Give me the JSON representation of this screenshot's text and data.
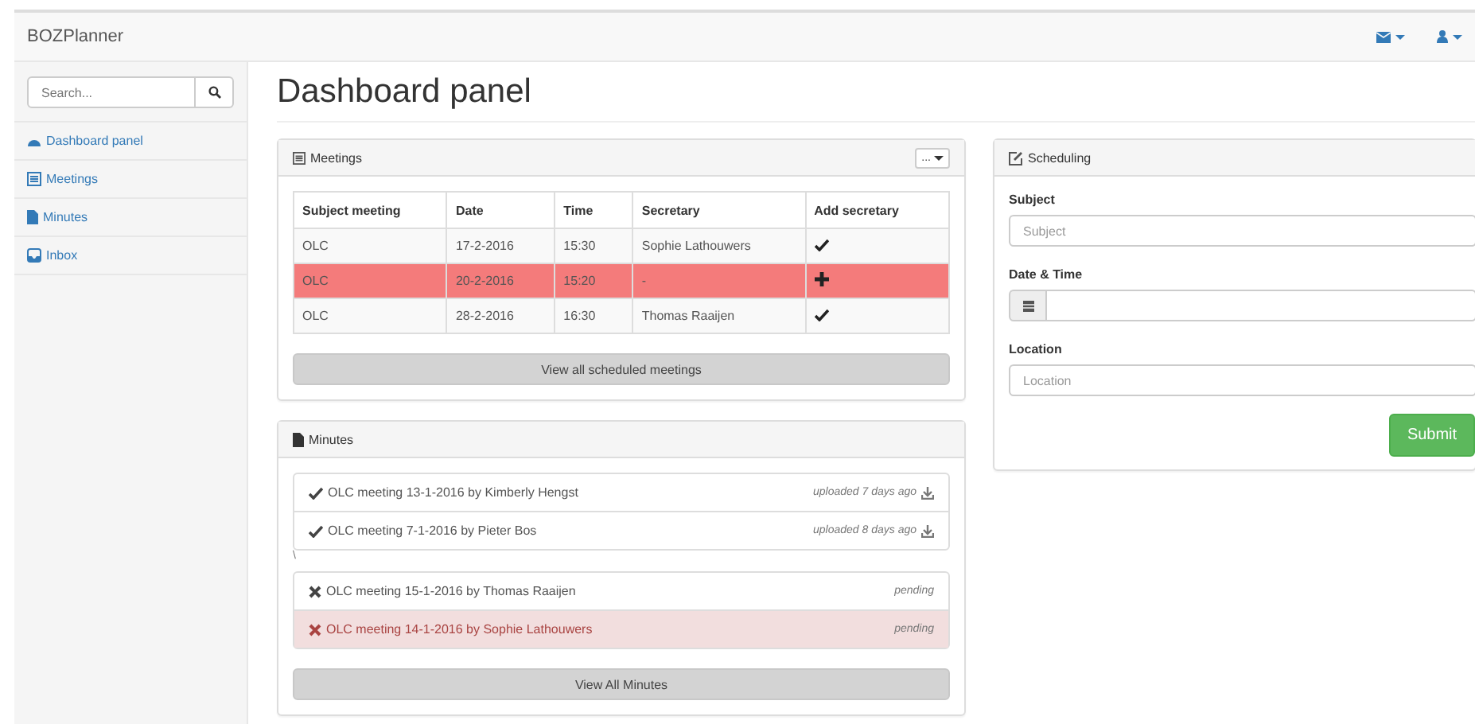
{
  "navbar": {
    "brand": "BOZPlanner"
  },
  "sidebar": {
    "search": {
      "placeholder": "Search..."
    },
    "items": [
      {
        "label": "Dashboard panel"
      },
      {
        "label": "Meetings"
      },
      {
        "label": "Minutes"
      },
      {
        "label": "Inbox"
      }
    ]
  },
  "page_title": "Dashboard panel",
  "meetings": {
    "title": "Meetings",
    "menu_label": "...",
    "columns": [
      "Subject meeting",
      "Date",
      "Time",
      "Secretary",
      "Add secretary"
    ],
    "rows": [
      {
        "cells": [
          "OLC",
          "17-2-2016",
          "15:30",
          "Sophie Lathouwers"
        ],
        "kind": "assigned",
        "danger": false
      },
      {
        "cells": [
          "OLC",
          "20-2-2016",
          "15:20",
          "-"
        ],
        "kind": "unassigned",
        "danger": true
      },
      {
        "cells": [
          "OLC",
          "28-2-2016",
          "16:30",
          "Thomas Raaijen"
        ],
        "kind": "assigned",
        "danger": false
      }
    ],
    "button": "View all scheduled meetings"
  },
  "minutes": {
    "title": "Minutes",
    "groups": [
      {
        "items": [
          {
            "text": "OLC meeting 13-1-2016 by Kimberly Hengst",
            "status": "uploaded 7 days ago",
            "kind": "done",
            "danger": false
          },
          {
            "text": "OLC meeting 7-1-2016 by Pieter Bos",
            "status": "uploaded 8 days ago",
            "kind": "done",
            "danger": false
          }
        ]
      },
      {
        "separator": "\\",
        "items": [
          {
            "text": "OLC meeting 15-1-2016 by Thomas Raaijen",
            "status": "pending",
            "kind": "pending",
            "danger": false
          },
          {
            "text": "OLC meeting 14-1-2016 by Sophie Lathouwers",
            "status": "pending",
            "kind": "pending",
            "danger": true
          }
        ]
      }
    ],
    "button": "View All Minutes"
  },
  "scheduling": {
    "title": "Scheduling",
    "fields": [
      {
        "label": "Subject",
        "placeholder": "Subject",
        "kind": "text"
      },
      {
        "label": "Date & Time",
        "kind": "date"
      },
      {
        "label": "Location",
        "placeholder": "Location",
        "kind": "text"
      }
    ],
    "submit": "Submit"
  }
}
